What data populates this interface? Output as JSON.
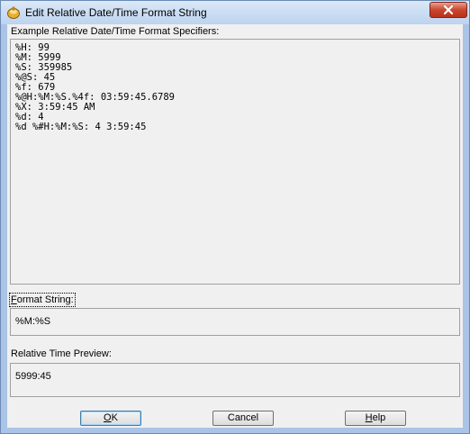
{
  "window": {
    "title": "Edit Relative Date/Time Format String",
    "close_icon": "close-icon"
  },
  "examples": {
    "label": "Example Relative Date/Time Format Specifiers:",
    "lines": [
      "%H: 99",
      "%M: 5999",
      "%S: 359985",
      "%@S: 45",
      "%f: 679",
      "%@H:%M:%S.%4f: 03:59:45.6789",
      "%X: 3:59:45 AM",
      "%d: 4",
      "%d %#H:%M:%S: 4 3:59:45"
    ]
  },
  "format": {
    "label": "Format String:",
    "value": "%M:%S"
  },
  "preview": {
    "label": "Relative Time Preview:",
    "value": "5999:45"
  },
  "buttons": {
    "ok": "OK",
    "cancel": "Cancel",
    "help": "Help"
  }
}
